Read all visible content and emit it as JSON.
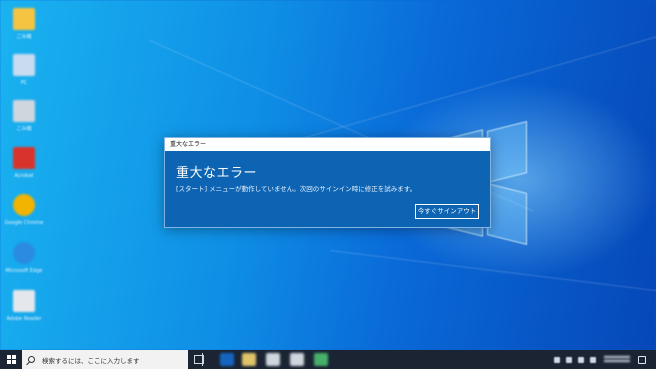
{
  "desktop": {
    "icons": [
      {
        "name": "folder-icon",
        "color": "#f5c542",
        "label": "ごみ箱"
      },
      {
        "name": "pc-icon",
        "color": "#c9dcef",
        "label": "PC"
      },
      {
        "name": "recycle-bin-icon",
        "color": "#cfd6de",
        "label": "ごみ箱"
      },
      {
        "name": "app-red-icon",
        "color": "#d9342b",
        "label": "Acrobat"
      },
      {
        "name": "chrome-icon",
        "color": "#f2b400",
        "label": "Google Chrome"
      },
      {
        "name": "edge-icon",
        "color": "#2a8be0",
        "label": "Microsoft Edge"
      },
      {
        "name": "document-icon",
        "color": "#e4e8ed",
        "label": "Adobe Reader"
      }
    ]
  },
  "dialog": {
    "title": "重大なエラー",
    "heading": "重大なエラー",
    "message": "[スタート] メニューが動作していません。次回のサインイン時に修正を試みます。",
    "button_label": "今すぐサインアウト"
  },
  "taskbar": {
    "search_placeholder": "検索するには、ここに入力します",
    "pinned": [
      {
        "name": "pinned-app-1-icon",
        "color": "#1565c0"
      },
      {
        "name": "pinned-app-2-icon",
        "color": "#e0c46a"
      },
      {
        "name": "pinned-app-3-icon",
        "color": "#cfd6de"
      },
      {
        "name": "pinned-app-4-icon",
        "color": "#cfd6de"
      },
      {
        "name": "pinned-app-5-icon",
        "color": "#47b06a"
      }
    ]
  },
  "colors": {
    "dialog_bg": "#0d64b3",
    "taskbar_bg": "#1a2433"
  }
}
